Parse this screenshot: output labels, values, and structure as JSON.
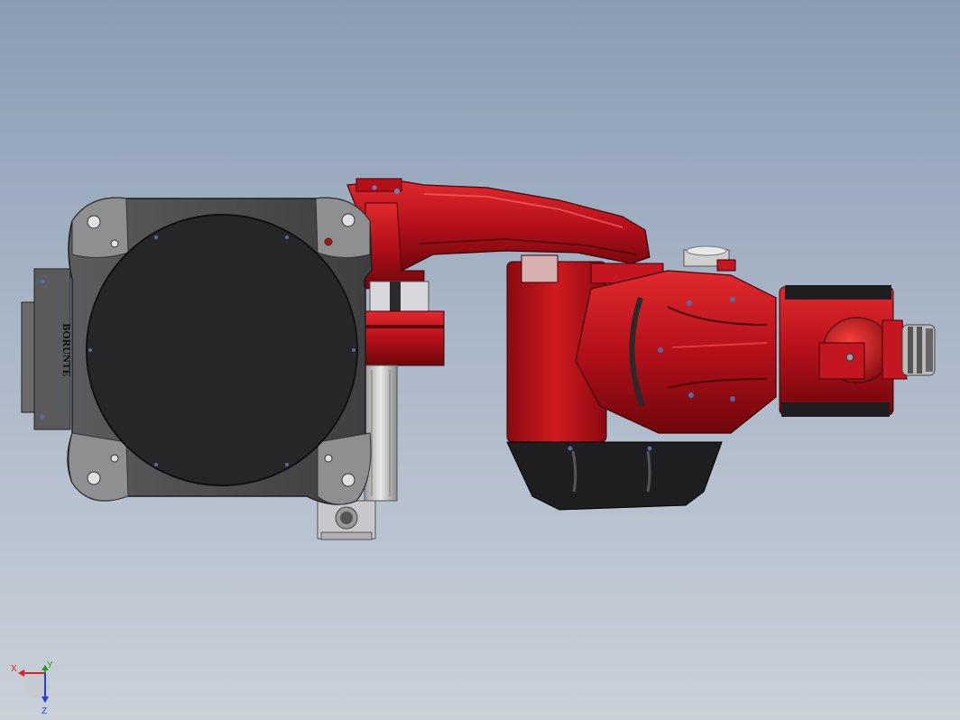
{
  "viewport": {
    "background_top": "#8a9cb3",
    "background_bottom": "#c9d0d8"
  },
  "model": {
    "brand_text": "BORUNTE",
    "colors": {
      "arm_red": "#c8141a",
      "arm_red_dark": "#7e0a0e",
      "base_gray": "#4a4a4c",
      "plate_gray": "#8a8a8c",
      "disc_black": "#262628"
    }
  },
  "triad": {
    "x_label": "X",
    "y_label": "Y",
    "z_label": "Z",
    "x_color": "#e02020",
    "y_color": "#20a020",
    "z_color": "#2040d0"
  }
}
